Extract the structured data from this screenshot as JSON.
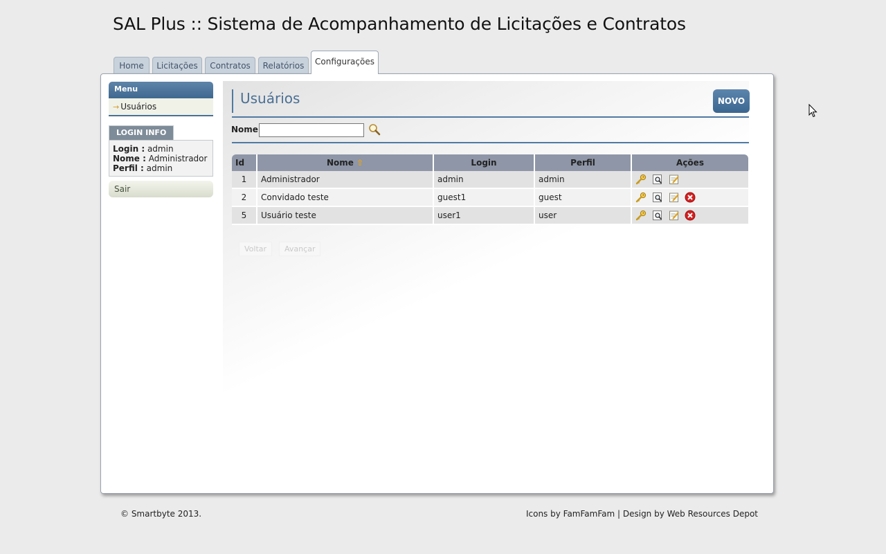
{
  "app": {
    "title": "SAL Plus :: Sistema de Acompanhamento de Licitações e Contratos"
  },
  "tabs": [
    {
      "label": "Home"
    },
    {
      "label": "Licitações"
    },
    {
      "label": "Contratos"
    },
    {
      "label": "Relatórios"
    },
    {
      "label": "Configurações",
      "active": true
    }
  ],
  "sidebar": {
    "menu_title": "Menu",
    "items": [
      {
        "label": "Usuários",
        "icon": "arrow-right-icon"
      }
    ],
    "login_info": {
      "title": "LOGIN INFO",
      "login_label": "Login :",
      "login_value": "admin",
      "name_label": "Nome :",
      "name_value": "Administrador",
      "profile_label": "Perfil :",
      "profile_value": "admin"
    },
    "logout_label": "Sair"
  },
  "main": {
    "title": "Usuários",
    "new_button": "NOVO",
    "search": {
      "label": "Nome",
      "value": "",
      "placeholder": "",
      "icon": "magnifier-icon"
    },
    "table": {
      "headers": {
        "id": "Id",
        "name": "Nome",
        "name_sort": "⇧",
        "login": "Login",
        "profile": "Perfil",
        "actions": "Ações"
      },
      "rows": [
        {
          "id": "1",
          "name": "Administrador",
          "login": "admin",
          "profile": "admin",
          "actions": [
            "key-icon",
            "view-icon",
            "edit-icon"
          ]
        },
        {
          "id": "2",
          "name": "Convidado teste",
          "login": "guest1",
          "profile": "guest",
          "actions": [
            "key-icon",
            "view-icon",
            "edit-icon",
            "delete-icon"
          ]
        },
        {
          "id": "5",
          "name": "Usuário teste",
          "login": "user1",
          "profile": "user",
          "actions": [
            "key-icon",
            "view-icon",
            "edit-icon",
            "delete-icon"
          ]
        }
      ]
    },
    "pager": {
      "prev": "Voltar",
      "next": "Avançar"
    }
  },
  "footer": {
    "copyright": "© Smartbyte 2013.",
    "credits": "Icons by FamFamFam | Design by Web Resources Depot"
  },
  "colors": {
    "accent": "#4a6f94",
    "header_bg": "#8e96a7",
    "delete": "#d42020",
    "key": "#e0b020"
  }
}
